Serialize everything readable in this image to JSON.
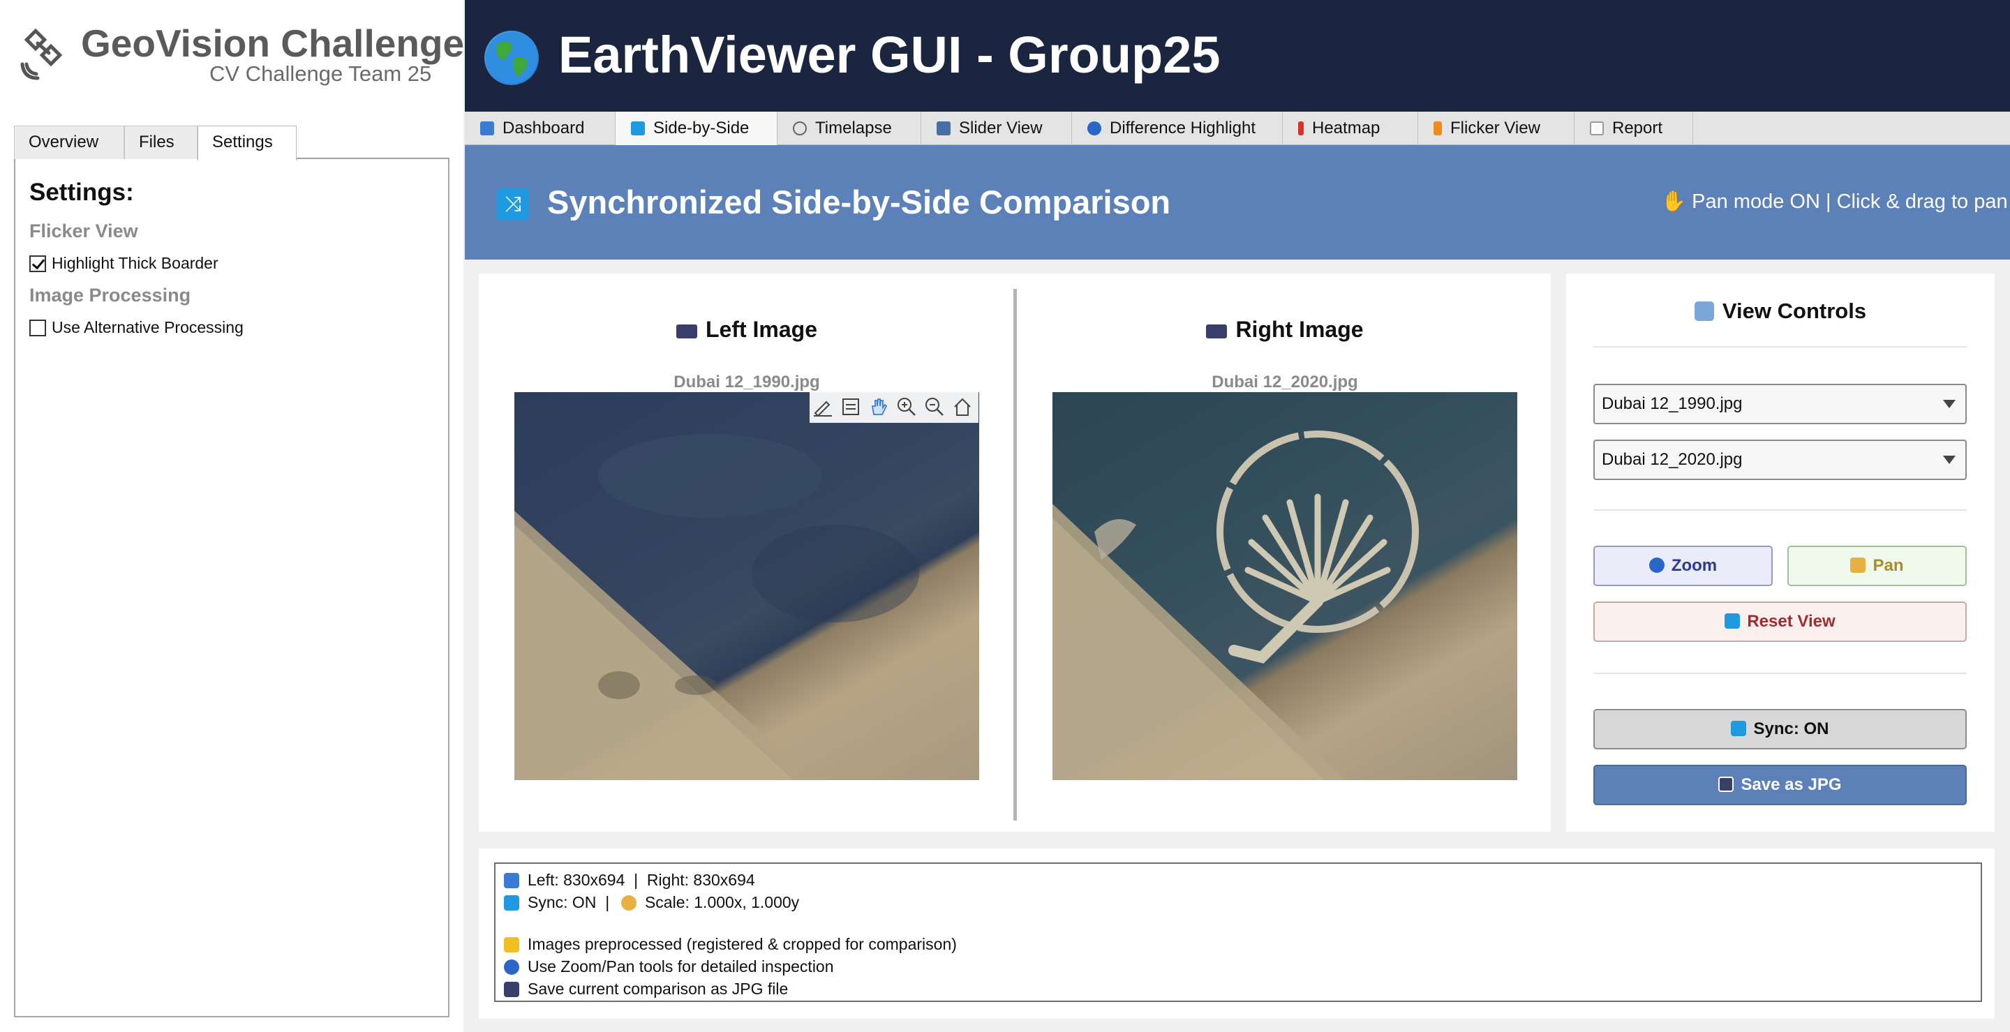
{
  "sidebar": {
    "app_name": "GeoVision Challenge",
    "app_subtitle": "CV Challenge Team 25",
    "tabs": [
      {
        "label": "Overview"
      },
      {
        "label": "Files"
      },
      {
        "label": "Settings",
        "active": true
      }
    ],
    "settings_title": "Settings:",
    "sections": [
      {
        "heading": "Flicker View",
        "option": {
          "label": "Highlight Thick Boarder",
          "checked": true
        }
      },
      {
        "heading": "Image Processing",
        "option": {
          "label": "Use Alternative Processing",
          "checked": false
        }
      }
    ]
  },
  "header": {
    "title": "EarthViewer GUI - Group25",
    "icon": "globe-icon"
  },
  "tabs": [
    {
      "label": "Dashboard",
      "icon": "bar-chart-icon"
    },
    {
      "label": "Side-by-Side",
      "icon": "shuffle-icon",
      "active": true
    },
    {
      "label": "Timelapse",
      "icon": "stopwatch-icon"
    },
    {
      "label": "Slider View",
      "icon": "slider-icon"
    },
    {
      "label": "Difference Highlight",
      "icon": "magnifier-icon"
    },
    {
      "label": "Heatmap",
      "icon": "thermometer-icon"
    },
    {
      "label": "Flicker View",
      "icon": "lightning-icon"
    },
    {
      "label": "Report",
      "icon": "document-icon"
    }
  ],
  "banner": {
    "title": "Synchronized Side-by-Side Comparison",
    "status": "✋ Pan mode ON | Click & drag to pan"
  },
  "comparison": {
    "left": {
      "heading": "Left Image",
      "filename": "Dubai 12_1990.jpg"
    },
    "right": {
      "heading": "Right Image",
      "filename": "Dubai 12_2020.jpg"
    }
  },
  "controls": {
    "title": "View Controls",
    "left_select": "Dubai 12_1990.jpg",
    "right_select": "Dubai 12_2020.jpg",
    "zoom_label": "Zoom",
    "pan_label": "Pan",
    "reset_label": "Reset View",
    "sync_label": "Sync: ON",
    "save_label": "Save as JPG"
  },
  "info": {
    "sizes": "Left: 830x694  |  Right: 830x694",
    "sync_scale_a": "Sync: ON  |  ",
    "sync_scale_b": "Scale: 1.000x, 1.000y",
    "tip1": "Images preprocessed (registered & cropped for comparison)",
    "tip2": "Use Zoom/Pan tools for detailed inspection",
    "tip3": "Save current comparison as JPG file"
  },
  "colors": {
    "header_bg": "#1b2540",
    "banner_bg": "#5b81b8",
    "save_button": "#5b81b8"
  }
}
